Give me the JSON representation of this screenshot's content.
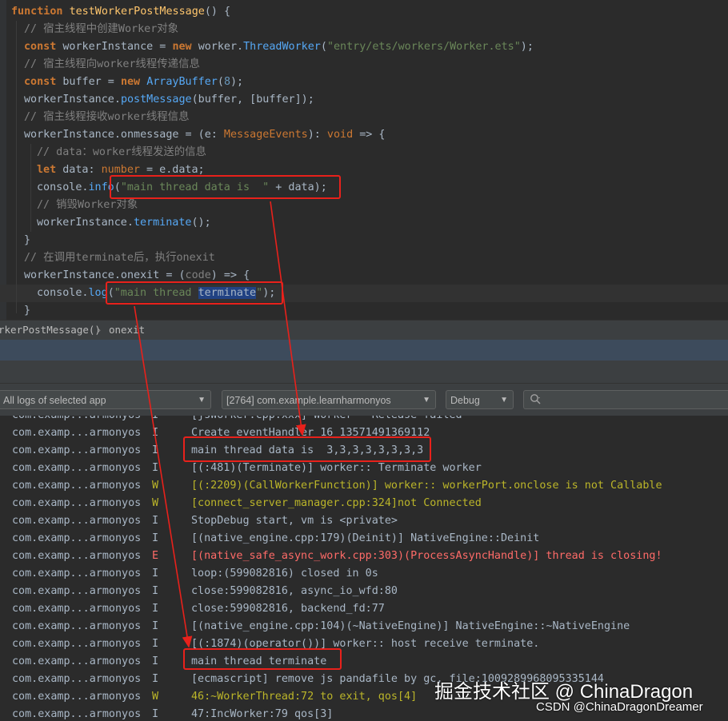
{
  "editor": {
    "lines": [
      {
        "parts": [
          [
            "kw",
            "function "
          ],
          [
            "fn",
            "testWorkerPostMessage"
          ],
          [
            "p",
            "() {"
          ]
        ]
      },
      {
        "parts": [
          [
            "cmt",
            "// 宿主线程中创建Worker对象"
          ]
        ]
      },
      {
        "parts": [
          [
            "kw",
            "const "
          ],
          [
            "p",
            "workerInstance = "
          ],
          [
            "kw",
            "new "
          ],
          [
            "p",
            "worker."
          ],
          [
            "method",
            "ThreadWorker"
          ],
          [
            "p",
            "("
          ],
          [
            "str",
            "\"entry/ets/workers/Worker.ets\""
          ],
          [
            "p",
            ");"
          ]
        ]
      },
      {
        "parts": [
          [
            "cmt",
            "// 宿主线程向worker线程传递信息"
          ]
        ]
      },
      {
        "parts": [
          [
            "kw",
            "const "
          ],
          [
            "p",
            "buffer = "
          ],
          [
            "kw",
            "new "
          ],
          [
            "method",
            "ArrayBuffer"
          ],
          [
            "p",
            "("
          ],
          [
            "num",
            "8"
          ],
          [
            "p",
            ");"
          ]
        ]
      },
      {
        "parts": [
          [
            "p",
            "workerInstance."
          ],
          [
            "method",
            "postMessage"
          ],
          [
            "p",
            "(buffer, [buffer]);"
          ]
        ]
      },
      {
        "parts": [
          [
            "cmt",
            "// 宿主线程接收worker线程信息"
          ]
        ]
      },
      {
        "parts": [
          [
            "p",
            "workerInstance.onmessage = (e: "
          ],
          [
            "typ",
            "MessageEvents"
          ],
          [
            "p",
            "): "
          ],
          [
            "typ",
            "void"
          ],
          [
            "p",
            " => {"
          ]
        ]
      },
      {
        "parts": [
          [
            "cmt",
            "// data：worker线程发送的信息"
          ]
        ]
      },
      {
        "parts": [
          [
            "kw",
            "let "
          ],
          [
            "p",
            "data: "
          ],
          [
            "typ",
            "number"
          ],
          [
            "p",
            " = e.data;"
          ]
        ]
      },
      {
        "parts": [
          [
            "p",
            "console."
          ],
          [
            "method",
            "info"
          ],
          [
            "p",
            "("
          ],
          [
            "str",
            "\"main thread data is  \""
          ],
          [
            "p",
            " + data);"
          ]
        ]
      },
      {
        "parts": [
          [
            "cmt",
            "// 销毁Worker对象"
          ]
        ]
      },
      {
        "parts": [
          [
            "p",
            "workerInstance."
          ],
          [
            "method",
            "terminate"
          ],
          [
            "p",
            "();"
          ]
        ]
      },
      {
        "parts": [
          [
            "p",
            "}"
          ]
        ]
      },
      {
        "parts": [
          [
            "cmt",
            "// 在调用terminate后，执行onexit"
          ]
        ]
      },
      {
        "parts": [
          [
            "p",
            "workerInstance.onexit = ("
          ],
          [
            "cmt",
            "code"
          ],
          [
            "p",
            ") => {"
          ]
        ]
      },
      {
        "parts": [
          [
            "p",
            "console."
          ],
          [
            "method",
            "log"
          ],
          [
            "p",
            "("
          ],
          [
            "str",
            "\"main thread "
          ],
          [
            "sel",
            "terminate"
          ],
          [
            "str",
            "\""
          ],
          [
            "p",
            ");"
          ]
        ]
      },
      {
        "parts": [
          [
            "p",
            "}"
          ]
        ]
      }
    ]
  },
  "breadcrumb": {
    "function_name": "rkerPostMessage()",
    "separator": "›",
    "member": "onexit"
  },
  "filters": {
    "log_scope": "All logs of selected app",
    "process": "[2764] com.example.learnharmonyos",
    "level": "Debug",
    "search_placeholder": ""
  },
  "logs": [
    {
      "src": "com.examp...armonyos",
      "lvl": "I",
      "msg": "[jsWorker.cpp:xxx] Worker ~ Release failed"
    },
    {
      "src": "com.examp...armonyos",
      "lvl": "I",
      "msg": "Create eventHandler 16_13571491369112"
    },
    {
      "src": "com.examp...armonyos",
      "lvl": "I",
      "msg": "main thread data is  3,3,3,3,3,3,3,3"
    },
    {
      "src": "com.examp...armonyos",
      "lvl": "I",
      "msg": "[(:481)(Terminate)] worker:: Terminate worker"
    },
    {
      "src": "com.examp...armonyos",
      "lvl": "W",
      "msg": "[(:2209)(CallWorkerFunction)] worker:: workerPort.onclose is not Callable"
    },
    {
      "src": "com.examp...armonyos",
      "lvl": "W",
      "msg": "[connect_server_manager.cpp:324]not Connected"
    },
    {
      "src": "com.examp...armonyos",
      "lvl": "I",
      "msg": "StopDebug start, vm is <private>"
    },
    {
      "src": "com.examp...armonyos",
      "lvl": "I",
      "msg": "[(native_engine.cpp:179)(Deinit)] NativeEngine::Deinit"
    },
    {
      "src": "com.examp...armonyos",
      "lvl": "E",
      "msg": "[(native_safe_async_work.cpp:303)(ProcessAsyncHandle)] thread is closing!"
    },
    {
      "src": "com.examp...armonyos",
      "lvl": "I",
      "msg": "loop:(599082816) closed in 0s"
    },
    {
      "src": "com.examp...armonyos",
      "lvl": "I",
      "msg": "close:599082816, async_io_wfd:80"
    },
    {
      "src": "com.examp...armonyos",
      "lvl": "I",
      "msg": "close:599082816, backend_fd:77"
    },
    {
      "src": "com.examp...armonyos",
      "lvl": "I",
      "msg": "[(native_engine.cpp:104)(~NativeEngine)] NativeEngine::~NativeEngine"
    },
    {
      "src": "com.examp...armonyos",
      "lvl": "I",
      "msg": "[(:1874)(operator())] worker:: host receive terminate."
    },
    {
      "src": "com.examp...armonyos",
      "lvl": "I",
      "msg": "main thread terminate"
    },
    {
      "src": "com.examp...armonyos",
      "lvl": "I",
      "msg": "[ecmascript] remove js pandafile by gc, file:1009289968095335144"
    },
    {
      "src": "com.examp...armonyos",
      "lvl": "W",
      "msg": "46:~WorkerThread:72 to exit, qos[4]"
    },
    {
      "src": "com.examp...armonyos",
      "lvl": "I",
      "msg": "47:IncWorker:79 qos[3]"
    }
  ],
  "watermark": {
    "main": "掘金技术社区 @ ChinaDragon",
    "sub": "CSDN @ChinaDragonDreamer"
  },
  "colors": {
    "annotation": "#e8211b",
    "warning": "#bbb529",
    "error": "#ff6b68"
  }
}
